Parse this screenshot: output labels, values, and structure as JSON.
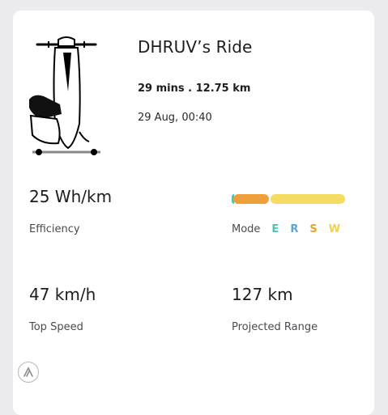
{
  "ride": {
    "title": "DHRUV’s Ride",
    "duration_distance": "29 mins . 12.75 km",
    "datetime": "29 Aug, 00:40"
  },
  "stats": {
    "efficiency": {
      "value": "25 Wh/km",
      "label": "Efficiency"
    },
    "top_speed": {
      "value": "47 km/h",
      "label": "Top Speed"
    },
    "projected_range": {
      "value": "127 km",
      "label": "Projected Range"
    }
  },
  "mode": {
    "label": "Mode",
    "letters": [
      {
        "letter": "E",
        "color": "#4fc4b5"
      },
      {
        "letter": "R",
        "color": "#56a7e0"
      },
      {
        "letter": "S",
        "color": "#e5a431"
      },
      {
        "letter": "W",
        "color": "#f1d24e"
      }
    ],
    "usage_fraction": {
      "E": 0.02,
      "R": 0,
      "S": 0.31,
      "W": 0.67
    }
  },
  "icons": {
    "scooter": "scooter-illustration",
    "brand": "ather-logo-icon"
  }
}
